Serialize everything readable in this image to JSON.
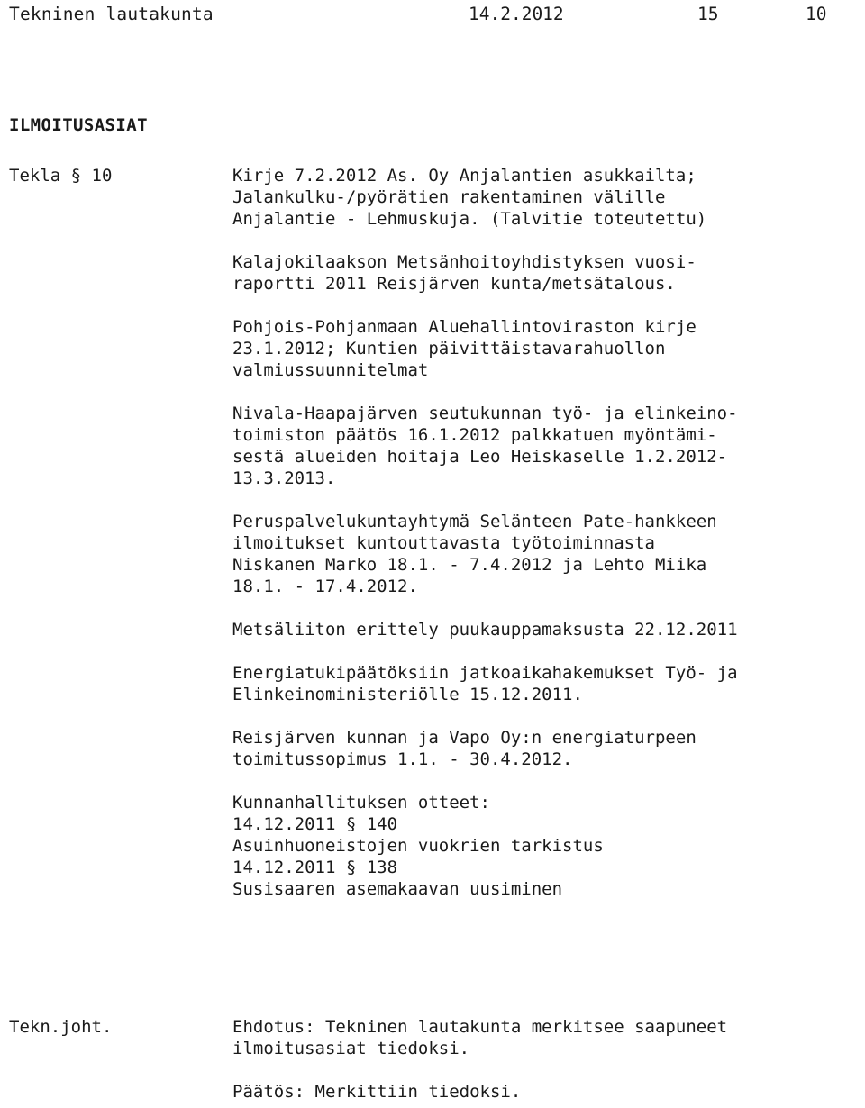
{
  "header": {
    "title": "Tekninen lautakunta",
    "date": "14.2.2012",
    "page_number": "15",
    "item_number": "10"
  },
  "section": {
    "heading": "ILMOITUSASIAT"
  },
  "blocks": [
    {
      "label": "Tekla § 10",
      "paragraphs": [
        [
          "Kirje 7.2.2012 As. Oy Anjalantien asukkailta;",
          "Jalankulku-/pyörätien rakentaminen välille",
          "Anjalantie - Lehmuskuja. (Talvitie toteutettu)"
        ],
        [
          "Kalajokilaakson Metsänhoitoyhdistyksen vuosi-",
          "raportti 2011 Reisjärven kunta/metsätalous."
        ],
        [
          "Pohjois-Pohjanmaan Aluehallintoviraston kirje",
          "23.1.2012; Kuntien päivittäistavarahuollon",
          "valmiussuunnitelmat"
        ],
        [
          "Nivala-Haapajärven seutukunnan työ- ja elinkeino-",
          "toimiston päätös 16.1.2012 palkkatuen myöntämi-",
          "sestä alueiden hoitaja Leo Heiskaselle 1.2.2012-",
          "13.3.2013."
        ],
        [
          "Peruspalvelukuntayhtymä Selänteen Pate-hankkeen",
          "ilmoitukset kuntouttavasta työtoiminnasta",
          "Niskanen Marko 18.1. - 7.4.2012 ja Lehto Miika",
          "18.1. - 17.4.2012."
        ],
        [
          "Metsäliiton erittely puukauppamaksusta 22.12.2011"
        ],
        [
          "Energiatukipäätöksiin jatkoaikahakemukset Työ- ja",
          "Elinkeinoministeriölle 15.12.2011."
        ],
        [
          "Reisjärven kunnan ja Vapo Oy:n energiaturpeen",
          "toimitussopimus 1.1. - 30.4.2012."
        ],
        [
          "Kunnanhallituksen otteet:",
          "14.12.2011 § 140",
          "Asuinhuoneistojen vuokrien tarkistus",
          "14.12.2011 § 138",
          "Susisaaren asemakaavan uusiminen"
        ]
      ]
    },
    {
      "label": "Tekn.joht.",
      "paragraphs": [
        [
          "Ehdotus: Tekninen lautakunta merkitsee saapuneet",
          "ilmoitusasiat tiedoksi."
        ],
        [
          "Päätös: Merkittiin tiedoksi."
        ]
      ]
    }
  ]
}
